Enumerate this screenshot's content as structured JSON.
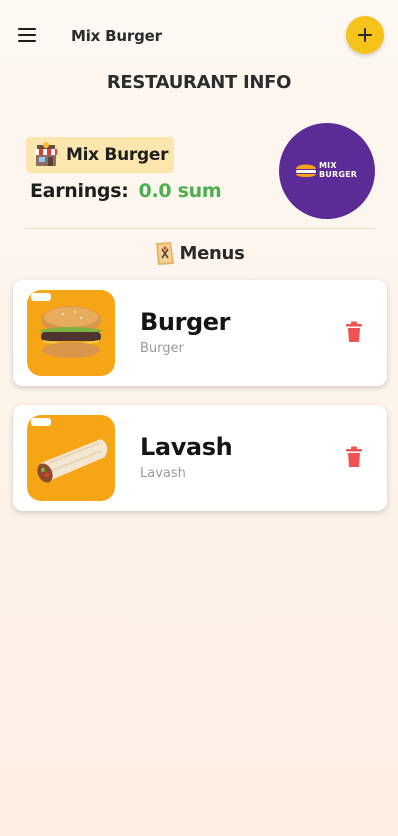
{
  "header": {
    "title": "Mix Burger"
  },
  "page": {
    "section_title": "RESTAURANT INFO"
  },
  "restaurant": {
    "name": "Mix Burger",
    "earnings_label": "Earnings:",
    "earnings_value": "0.0 sum",
    "logo_text_line1": "MIX",
    "logo_text_line2": "BURGER"
  },
  "menus": {
    "heading": "Menus",
    "items": [
      {
        "title": "Burger",
        "subtitle": "Burger"
      },
      {
        "title": "Lavash",
        "subtitle": "Lavash"
      }
    ]
  },
  "colors": {
    "accent": "#f4c21b",
    "earnings": "#4caf50",
    "delete": "#ef5350",
    "logo_bg": "#5c2c96"
  }
}
